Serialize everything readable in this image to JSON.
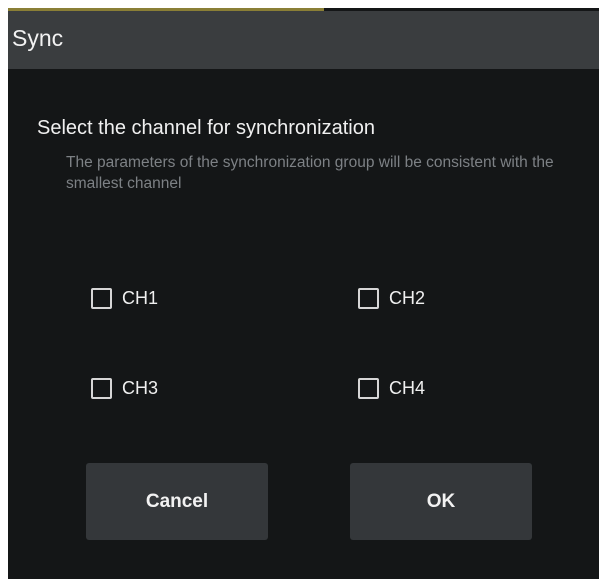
{
  "dialog": {
    "title": "Sync",
    "heading": "Select the channel for synchronization",
    "description": "The parameters of the synchronization group will be consistent with the smallest channel"
  },
  "channels": [
    {
      "label": "CH1",
      "checked": false
    },
    {
      "label": "CH2",
      "checked": false
    },
    {
      "label": "CH3",
      "checked": false
    },
    {
      "label": "CH4",
      "checked": false
    }
  ],
  "buttons": {
    "cancel": "Cancel",
    "ok": "OK"
  },
  "icons": {
    "checkbox": "checkbox-unchecked-icon"
  },
  "colors": {
    "background": "#141617",
    "titlebar": "#3a3d3f",
    "button": "#34373a",
    "accent": "#8a7f36",
    "text": "#f0f0f0",
    "muted_text": "#7d8185"
  }
}
